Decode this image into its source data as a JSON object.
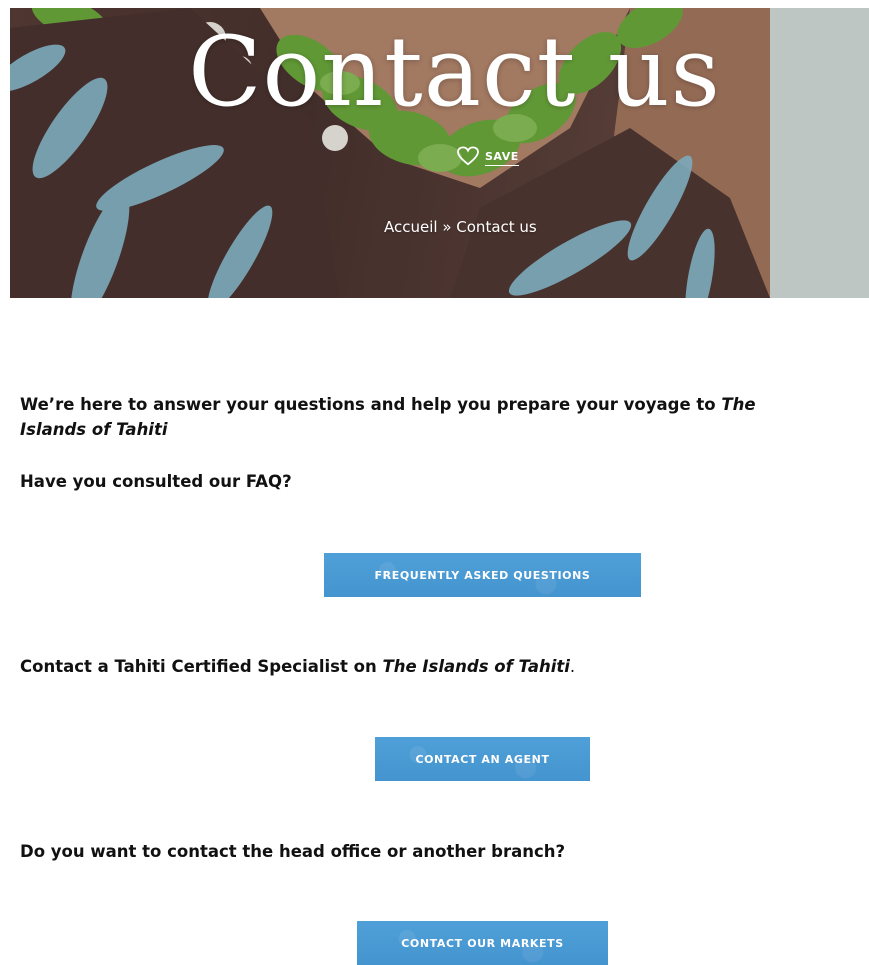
{
  "hero": {
    "title": "Contact us",
    "save_label": "SAVE",
    "breadcrumb": {
      "home": "Accueil",
      "separator": " » ",
      "current": "Contact us"
    }
  },
  "content": {
    "intro_part1": "We’re here to answer your questions and help you prepare your voyage to ",
    "intro_em1": "The",
    "intro_em2": "Islands of Tahiti",
    "faq_question": "Have you consulted our FAQ?",
    "faq_button": "FREQUENTLY ASKED QUESTIONS",
    "specialist_text": "Contact a Tahiti Certified Specialist on ",
    "specialist_em": "The Islands of Tahiti",
    "specialist_trail": ".",
    "agent_button": "CONTACT AN AGENT",
    "office_question": "Do you want to contact the head office or another branch?",
    "markets_button": "CONTACT OUR MARKETS"
  },
  "colors": {
    "button": "#4a9bd4",
    "text": "#111111",
    "hero_text": "#ffffff"
  },
  "icons": {
    "save": "heart-outline-icon"
  }
}
